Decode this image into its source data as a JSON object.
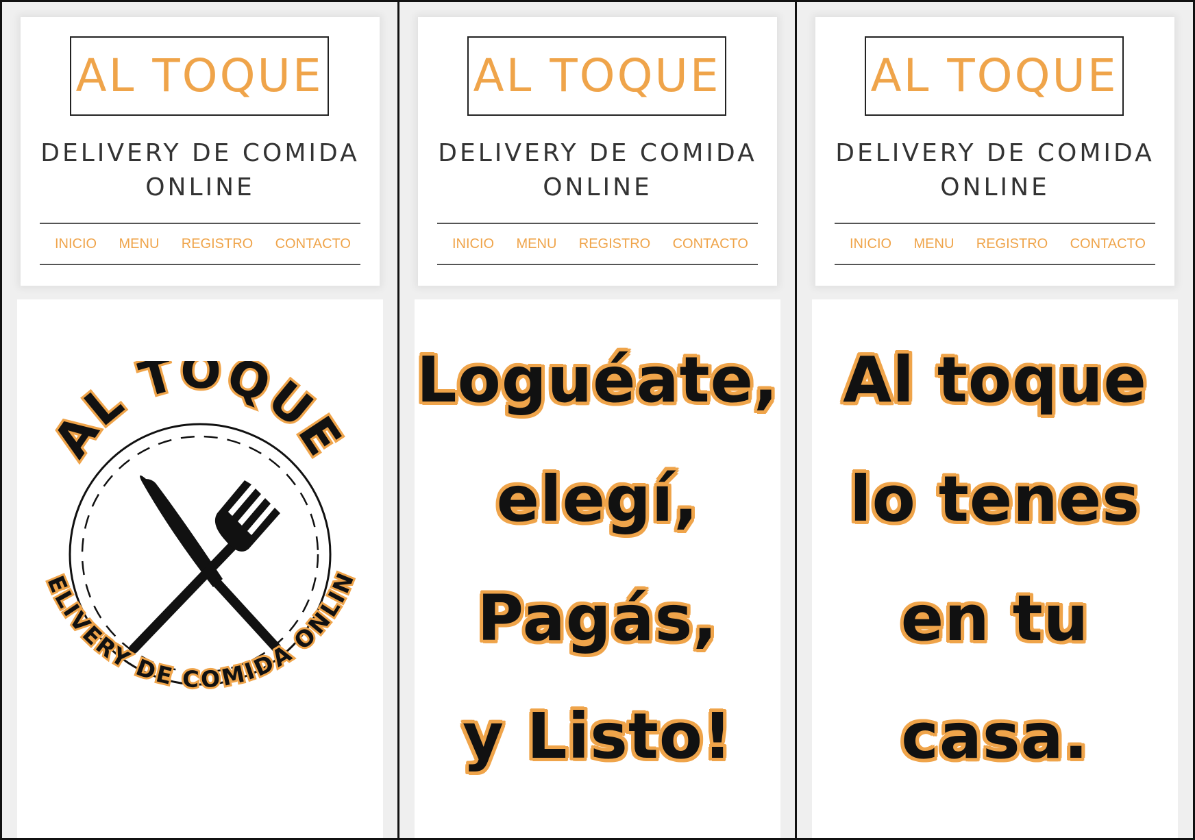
{
  "header": {
    "logo_text": "AL TOQUE",
    "tagline_line1": "DELIVERY DE COMIDA",
    "tagline_line2": "ONLINE",
    "nav": [
      "INICIO",
      "MENU",
      "REGISTRO",
      "CONTACTO"
    ]
  },
  "emblem": {
    "top_text": "AL TOQUE",
    "bottom_text": "DELIVERY DE COMIDA ONLINE",
    "icon": "knife-and-fork-icon"
  },
  "panel2": {
    "lines": [
      "Loguéate,",
      "elegí,",
      "Pagás,",
      "y Listo!"
    ]
  },
  "panel3": {
    "lines": [
      "Al toque",
      "lo tenes",
      "en tu",
      "casa."
    ]
  },
  "colors": {
    "accent": "#efa44a",
    "text": "#333333",
    "background": "#efefef",
    "card": "#ffffff"
  }
}
